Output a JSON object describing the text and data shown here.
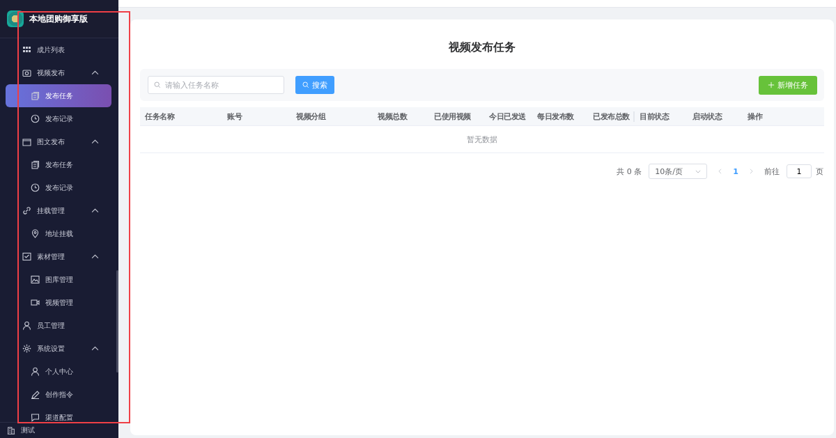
{
  "app": {
    "title": "本地团购御享版"
  },
  "menu": [
    {
      "label": "成片列表",
      "selected": false
    },
    {
      "label": "视频发布",
      "expanded": true,
      "children": [
        {
          "label": "发布任务",
          "selected": true
        },
        {
          "label": "发布记录",
          "selected": false
        }
      ]
    },
    {
      "label": "图文发布",
      "expanded": true,
      "children": [
        {
          "label": "发布任务",
          "selected": false
        },
        {
          "label": "发布记录",
          "selected": false
        }
      ]
    },
    {
      "label": "挂载管理",
      "expanded": true,
      "children": [
        {
          "label": "地址挂载",
          "selected": false
        }
      ]
    },
    {
      "label": "素材管理",
      "expanded": true,
      "children": [
        {
          "label": "图库管理",
          "selected": false
        },
        {
          "label": "视频管理",
          "selected": false
        }
      ]
    },
    {
      "label": "员工管理",
      "selected": false
    },
    {
      "label": "系统设置",
      "expanded": true,
      "children": [
        {
          "label": "个人中心",
          "selected": false
        },
        {
          "label": "创作指令",
          "selected": false
        },
        {
          "label": "渠道配置",
          "selected": false
        }
      ]
    }
  ],
  "footer": {
    "label": "测试"
  },
  "page": {
    "title": "视频发布任务",
    "search": {
      "placeholder": "请输入任务名称",
      "button": "搜索"
    },
    "add_button": "新增任务",
    "table": {
      "columns": [
        "任务名称",
        "账号",
        "视频分组",
        "视频总数",
        "已使用视频",
        "今日已发送",
        "每日发布数",
        "已发布总数",
        "目前状态",
        "启动状态",
        "操作"
      ],
      "empty_text": "暂无数据"
    },
    "pagination": {
      "total": "共 0 条",
      "page_size": "10条/页",
      "pages": [
        {
          "label": "1",
          "selected": true
        }
      ],
      "goto_label": "前往",
      "goto_value": "1",
      "goto_suffix": "页"
    }
  }
}
